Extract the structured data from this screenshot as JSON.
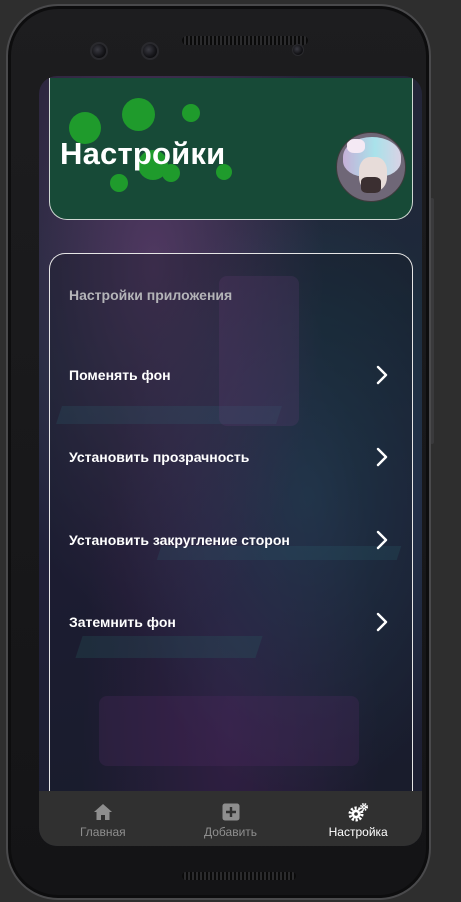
{
  "header": {
    "title": "Настройки",
    "avatar_icon": "profile-avatar"
  },
  "settings": {
    "section_title": "Настройки приложения",
    "items": [
      {
        "label": "Поменять фон",
        "icon": "chevron-right-icon"
      },
      {
        "label": "Установить прозрачность",
        "icon": "chevron-right-icon"
      },
      {
        "label": "Установить закругление сторон",
        "icon": "chevron-right-icon"
      },
      {
        "label": "Затемнить фон",
        "icon": "chevron-right-icon"
      }
    ]
  },
  "nav": {
    "items": [
      {
        "label": "Главная",
        "icon": "home-icon",
        "active": false
      },
      {
        "label": "Добавить",
        "icon": "add-box-icon",
        "active": false
      },
      {
        "label": "Настройка",
        "icon": "settings-gears-icon",
        "active": true
      }
    ]
  },
  "colors": {
    "header_bg": "#174a37",
    "bubble": "#1f9b2c",
    "nav_bg": "#303030",
    "nav_active": "#ffffff",
    "nav_inactive": "#8e8e8e"
  }
}
